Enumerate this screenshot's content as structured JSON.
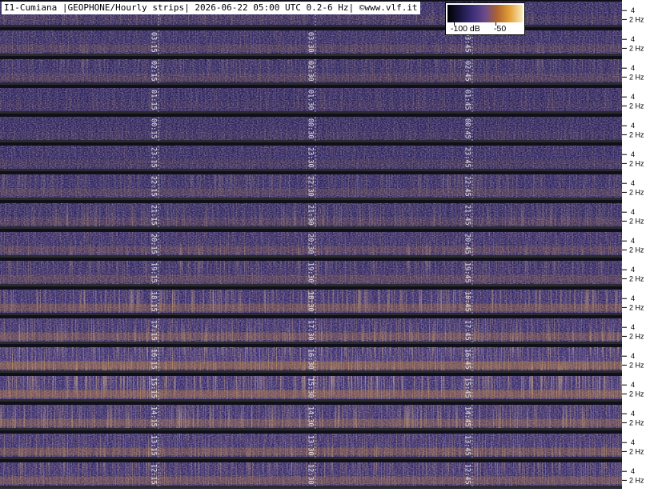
{
  "header": {
    "text": "I1-Cumiana |GEOPHONE/Hourly strips| 2026-06-22 05:00 UTC 0.2-6 Hz| ©www.vlf.it"
  },
  "color_scale": {
    "labels": [
      "-100 dB",
      "-50"
    ],
    "stops": [
      "#000000",
      "#191640",
      "#3c2e78",
      "#6a4a8a",
      "#b0662e",
      "#e6a23a",
      "#f7ecc0"
    ]
  },
  "chart_data": {
    "type": "heatmap",
    "title": "I1-Cumiana |GEOPHONE/Hourly strips| 2026-06-22 05:00 UTC 0.2-6 Hz| ©www.vlf.it",
    "xlabel": "",
    "ylabel": "",
    "freq_range_hz": [
      0.2,
      6
    ],
    "freq_ticks": [
      "4",
      "2 Hz"
    ],
    "color_scale_db": [
      -100,
      -50
    ],
    "strips": [
      {
        "labels": [
          "04",
          "04"
        ],
        "activity": 0.15
      },
      {
        "labels": [
          "03:15",
          "03:30",
          "03:45"
        ],
        "activity": 0.25
      },
      {
        "labels": [
          "02:15",
          "02:30",
          "02:45"
        ],
        "activity": 0.25
      },
      {
        "labels": [
          "01:15",
          "01:30",
          "01:45"
        ],
        "activity": 0.1
      },
      {
        "labels": [
          "00:15",
          "00:30",
          "00:45"
        ],
        "activity": 0.1
      },
      {
        "labels": [
          "23:15",
          "23:30",
          "23:45"
        ],
        "activity": 0.15
      },
      {
        "labels": [
          "22:15",
          "22:30",
          "22:45"
        ],
        "activity": 0.25
      },
      {
        "labels": [
          "21:15",
          "21:30",
          "21:45"
        ],
        "activity": 0.25
      },
      {
        "labels": [
          "20:15",
          "20:30",
          "20:45"
        ],
        "activity": 0.35
      },
      {
        "labels": [
          "19:15",
          "19:30",
          "19:45"
        ],
        "activity": 0.35
      },
      {
        "labels": [
          "18:15",
          "18:30",
          "18:45"
        ],
        "activity": 0.55
      },
      {
        "labels": [
          "17:15",
          "17:30",
          "17:45"
        ],
        "activity": 0.55
      },
      {
        "labels": [
          "16:15",
          "16:30",
          "16:45"
        ],
        "activity": 0.8
      },
      {
        "labels": [
          "15:15",
          "15:30",
          "15:45"
        ],
        "activity": 0.75
      },
      {
        "labels": [
          "14:15",
          "14:30",
          "14:45"
        ],
        "activity": 0.6
      },
      {
        "labels": [
          "13:15",
          "13:30",
          "13:45"
        ],
        "activity": 0.55
      },
      {
        "labels": [
          "12:15",
          "12:30",
          "12:45"
        ],
        "activity": 0.55
      }
    ]
  }
}
